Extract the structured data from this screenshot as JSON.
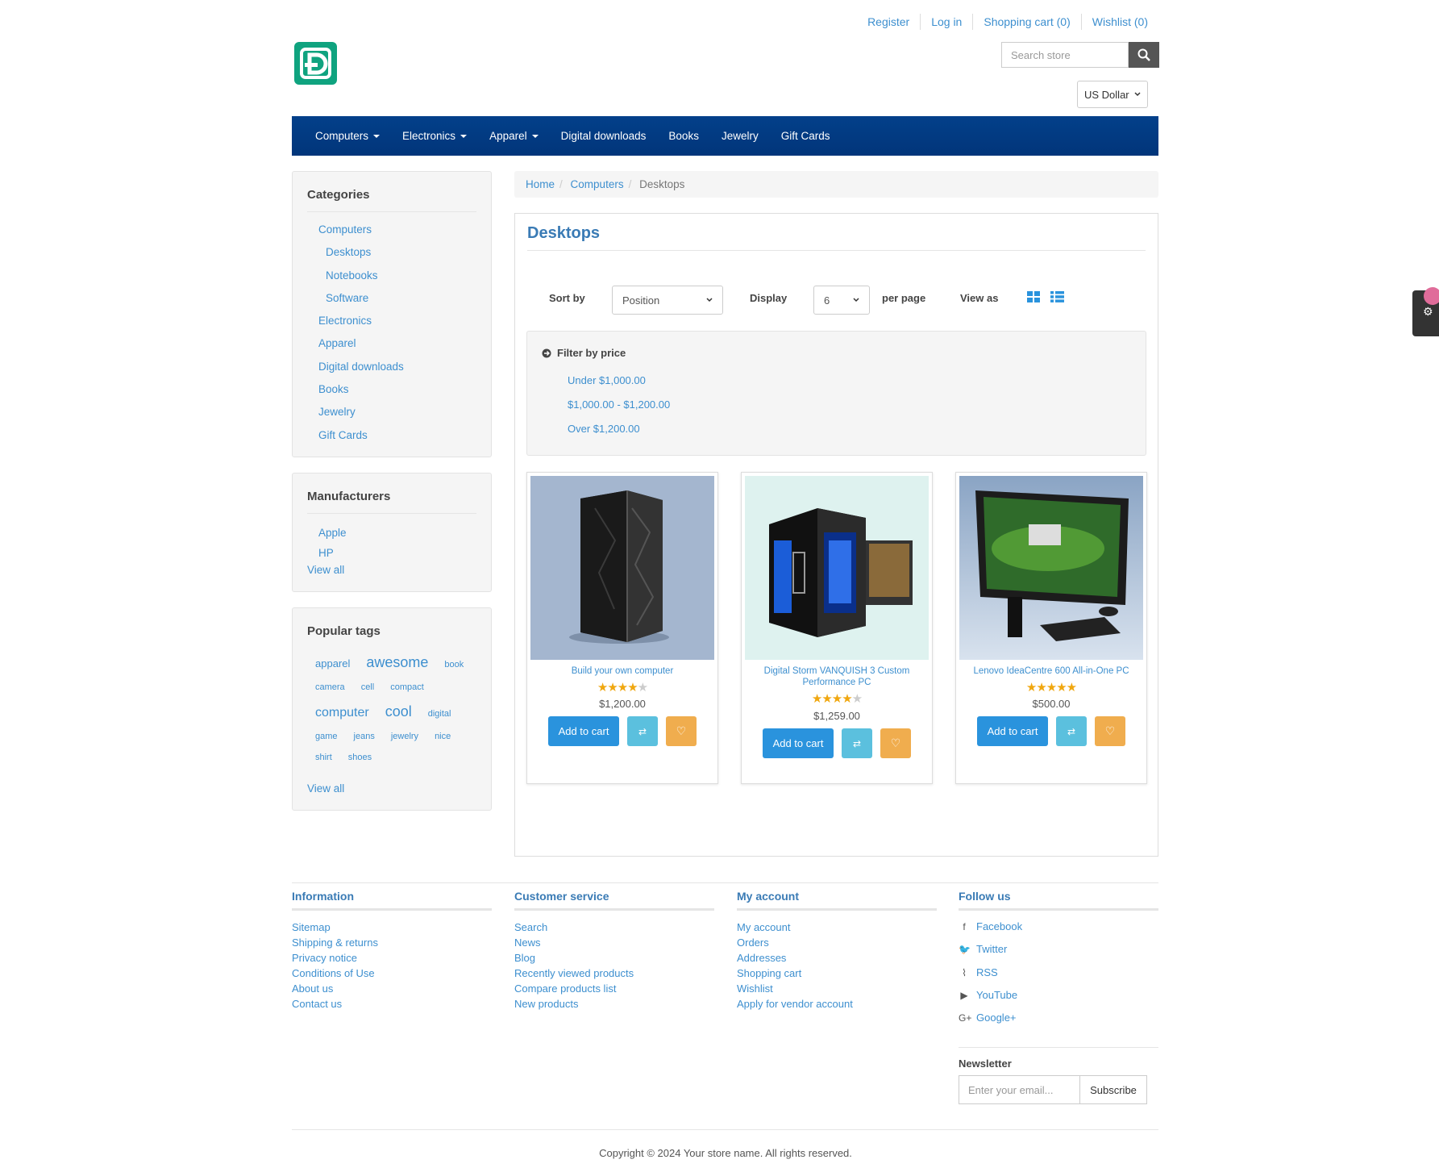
{
  "header": {
    "links": [
      "Register",
      "Log in",
      "Shopping cart (0)",
      "Wishlist (0)"
    ],
    "search_placeholder": "Search store",
    "currency": "US Dollar"
  },
  "nav": [
    {
      "label": "Computers",
      "dropdown": true
    },
    {
      "label": "Electronics",
      "dropdown": true
    },
    {
      "label": "Apparel",
      "dropdown": true
    },
    {
      "label": "Digital downloads",
      "dropdown": false
    },
    {
      "label": "Books",
      "dropdown": false
    },
    {
      "label": "Jewelry",
      "dropdown": false
    },
    {
      "label": "Gift Cards",
      "dropdown": false
    }
  ],
  "sidebar": {
    "categories_title": "Categories",
    "categories": [
      {
        "label": "Computers",
        "sub": false
      },
      {
        "label": "Desktops",
        "sub": true
      },
      {
        "label": "Notebooks",
        "sub": true
      },
      {
        "label": "Software",
        "sub": true
      },
      {
        "label": "Electronics",
        "sub": false
      },
      {
        "label": "Apparel",
        "sub": false
      },
      {
        "label": "Digital downloads",
        "sub": false
      },
      {
        "label": "Books",
        "sub": false
      },
      {
        "label": "Jewelry",
        "sub": false
      },
      {
        "label": "Gift Cards",
        "sub": false
      }
    ],
    "manufacturers_title": "Manufacturers",
    "manufacturers": [
      "Apple",
      "HP"
    ],
    "manufacturers_view_all": "View all",
    "tags_title": "Popular tags",
    "tags": [
      {
        "label": "apparel",
        "size": 13
      },
      {
        "label": "awesome",
        "size": 18
      },
      {
        "label": "book",
        "size": 11
      },
      {
        "label": "camera",
        "size": 11
      },
      {
        "label": "cell",
        "size": 11
      },
      {
        "label": "compact",
        "size": 11
      },
      {
        "label": "computer",
        "size": 16
      },
      {
        "label": "cool",
        "size": 18
      },
      {
        "label": "digital",
        "size": 11
      },
      {
        "label": "game",
        "size": 11
      },
      {
        "label": "jeans",
        "size": 11
      },
      {
        "label": "jewelry",
        "size": 11
      },
      {
        "label": "nice",
        "size": 11
      },
      {
        "label": "shirt",
        "size": 11
      },
      {
        "label": "shoes",
        "size": 11
      }
    ],
    "tags_view_all": "View all"
  },
  "breadcrumb": {
    "home": "Home",
    "parent": "Computers",
    "current": "Desktops"
  },
  "main": {
    "title": "Desktops",
    "sort_label": "Sort by",
    "sort_value": "Position",
    "display_label": "Display",
    "display_value": "6",
    "per_page_label": "per page",
    "view_label": "View as",
    "filter_title": "Filter by price",
    "price_ranges": [
      "Under $1,000.00",
      "$1,000.00 - $1,200.00",
      "Over $1,200.00"
    ],
    "products": [
      {
        "name": "Build your own computer",
        "rating": 4,
        "price": "$1,200.00"
      },
      {
        "name": "Digital Storm VANQUISH 3 Custom Performance PC",
        "rating": 4,
        "price": "$1,259.00"
      },
      {
        "name": "Lenovo IdeaCentre 600 All-in-One PC",
        "rating": 5,
        "price": "$500.00"
      }
    ],
    "add_to_cart": "Add to cart"
  },
  "footer": {
    "information_title": "Information",
    "information": [
      "Sitemap",
      "Shipping & returns",
      "Privacy notice",
      "Conditions of Use",
      "About us",
      "Contact us"
    ],
    "service_title": "Customer service",
    "service": [
      "Search",
      "News",
      "Blog",
      "Recently viewed products",
      "Compare products list",
      "New products"
    ],
    "account_title": "My account",
    "account": [
      "My account",
      "Orders",
      "Addresses",
      "Shopping cart",
      "Wishlist",
      "Apply for vendor account"
    ],
    "follow_title": "Follow us",
    "follow": [
      {
        "label": "Facebook",
        "icon": "facebook-icon"
      },
      {
        "label": "Twitter",
        "icon": "twitter-icon"
      },
      {
        "label": "RSS",
        "icon": "rss-icon"
      },
      {
        "label": "YouTube",
        "icon": "youtube-icon"
      },
      {
        "label": "Google+",
        "icon": "google-plus-icon"
      }
    ],
    "newsletter_title": "Newsletter",
    "newsletter_placeholder": "Enter your email...",
    "subscribe": "Subscribe",
    "copyright": "Copyright © 2024 Your store name. All rights reserved."
  },
  "colors": {
    "nav": "#03408a",
    "link": "#3d8fcf",
    "cart_button": "#2a93dd",
    "compare_button": "#5bc0de",
    "wishlist_button": "#f0ad4e",
    "star": "#f0a70f"
  }
}
